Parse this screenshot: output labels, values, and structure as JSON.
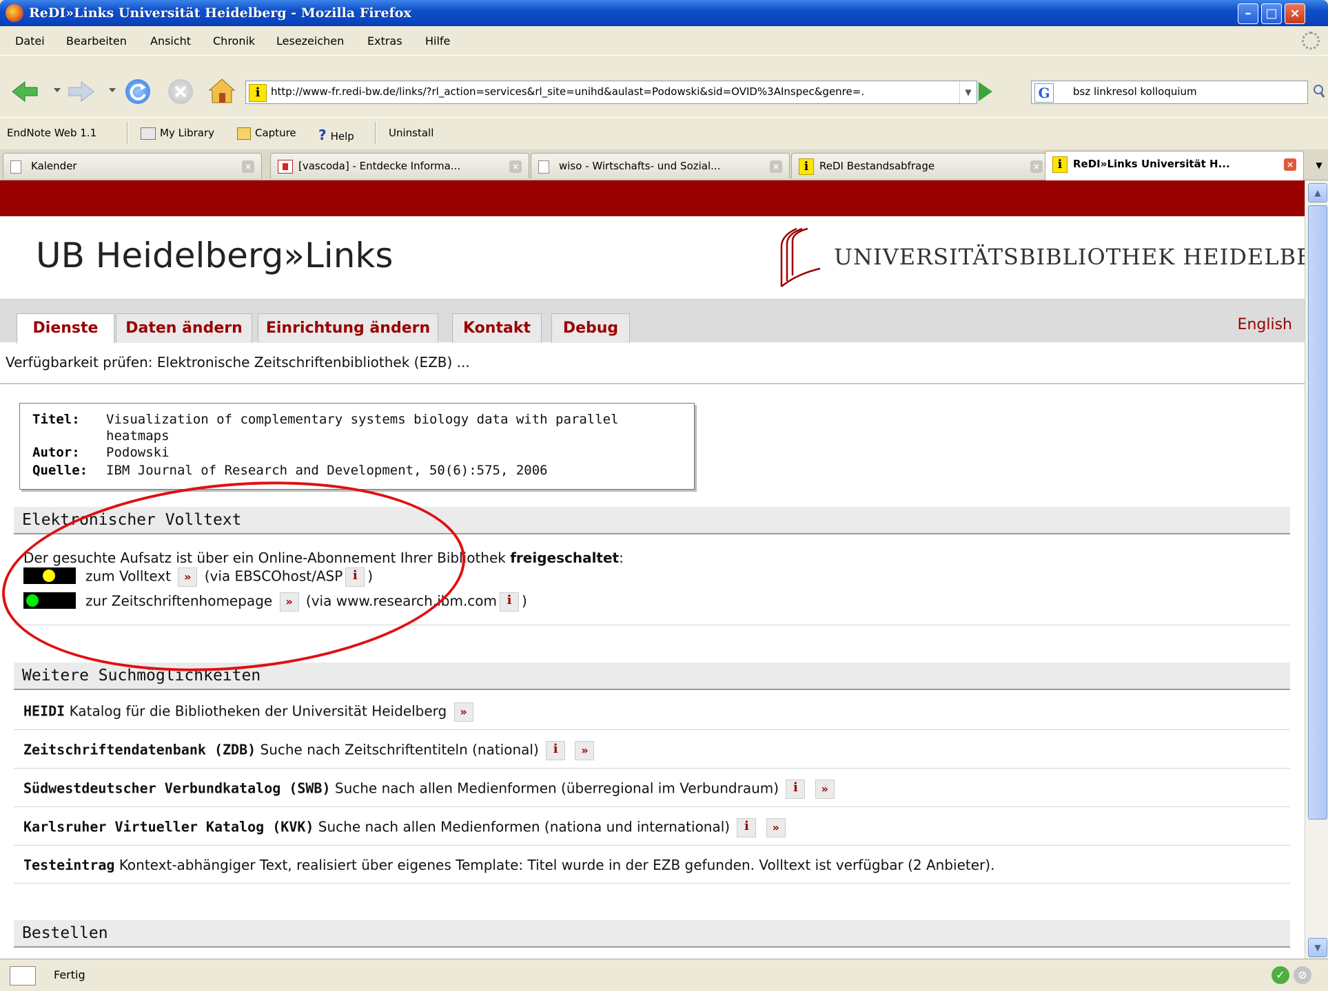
{
  "window": {
    "title": "ReDI»Links Universität Heidelberg - Mozilla Firefox"
  },
  "menu": [
    "Datei",
    "Bearbeiten",
    "Ansicht",
    "Chronik",
    "Lesezeichen",
    "Extras",
    "Hilfe"
  ],
  "navigation": {
    "url": "http://www-fr.redi-bw.de/links/?rl_action=services&rl_site=unihd&aulast=Podowski&sid=OVID%3AInspec&genre=.",
    "search_value": "bsz linkresol kolloquium"
  },
  "endnote_toolbar": {
    "title": "EndNote Web 1.1",
    "my_library": "My Library",
    "capture": "Capture",
    "help": "Help",
    "uninstall": "Uninstall"
  },
  "tabs": [
    {
      "label": "Kalender",
      "active": false
    },
    {
      "label": "[vascoda] - Entdecke Informa...",
      "active": false
    },
    {
      "label": "wiso - Wirtschafts- und Sozial...",
      "active": false
    },
    {
      "label": "ReDI Bestandsabfrage",
      "active": false
    },
    {
      "label": "ReDI»Links Universität H...",
      "active": true
    }
  ],
  "page": {
    "site_title": "UB Heidelberg»Links",
    "library_name": "UNIVERSITÄTSBIBLIOTHEK HEIDELBERG",
    "nav_tabs": [
      "Dienste",
      "Daten ändern",
      "Einrichtung ändern",
      "Kontakt",
      "Debug"
    ],
    "active_nav_tab": "Dienste",
    "language_link": "English",
    "availability_check": "Verfügbarkeit prüfen: Elektronische Zeitschriftenbibliothek (EZB) ...",
    "citation": {
      "title_label": "Titel:",
      "title_line1": "Visualization of complementary systems biology data with parallel",
      "title_line2": "heatmaps",
      "author_label": "Autor:",
      "author": "Podowski",
      "source_label": "Quelle:",
      "source": "IBM Journal of Research and Development, 50(6):575, 2006"
    },
    "fulltext": {
      "heading": "Elektronischer Volltext",
      "intro_prefix": "Der gesuchte Aufsatz ist über ein Online-Abonnement Ihrer Bibliothek",
      "intro_bold": "freigeschaltet",
      "intro_suffix": ":",
      "links": [
        {
          "label": "zum Volltext",
          "via": "(via EBSCOhost/ASP",
          "close": ")",
          "status_color": "#ffff00"
        },
        {
          "label": "zur Zeitschriftenhomepage",
          "via": "(via www.research.ibm.com",
          "close": ")",
          "status_color": "#00ee00"
        }
      ]
    },
    "more_search": {
      "heading": "Weitere Suchmöglichkeiten",
      "rows": [
        {
          "name": "HEIDI",
          "desc": "Katalog für die Bibliotheken der Universität Heidelberg"
        },
        {
          "name": "Zeitschriftendatenbank (ZDB)",
          "desc": "Suche nach Zeitschriftentiteln (national)"
        },
        {
          "name": "Südwestdeutscher Verbundkatalog (SWB)",
          "desc": "Suche nach allen Medienformen (überregional im Verbundraum)"
        },
        {
          "name": "Karlsruher Virtueller Katalog (KVK)",
          "desc": "Suche nach allen Medienformen (nationa und international)"
        },
        {
          "name": "Testeintrag",
          "desc": "Kontext-abhängiger Text, realisiert über eigenes Template: Titel wurde in der EZB gefunden. Volltext ist verfügbar (2 Anbieter)."
        }
      ]
    },
    "order": {
      "heading": "Bestellen"
    },
    "link_glyph": "»",
    "info_glyph": "i"
  },
  "status": {
    "text": "Fertig"
  },
  "colors": {
    "brand": "#990000",
    "titlebar": "#0a46c2"
  }
}
